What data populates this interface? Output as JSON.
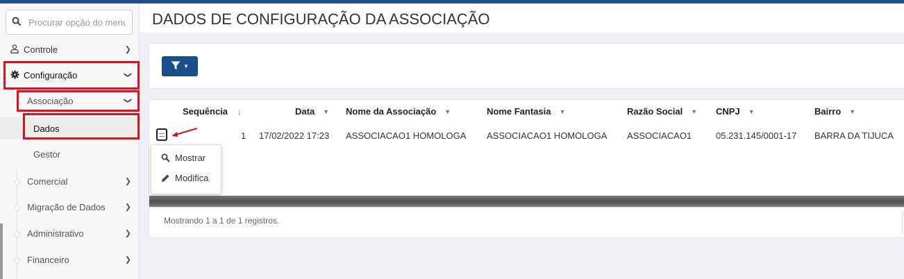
{
  "sidebar": {
    "search_placeholder": "Procurar opção do menu",
    "items": [
      {
        "label": "Controle"
      },
      {
        "label": "Configuração"
      },
      {
        "label": "Associação"
      },
      {
        "label": "Dados"
      },
      {
        "label": "Gestor"
      },
      {
        "label": "Comercial"
      },
      {
        "label": "Migração de Dados"
      },
      {
        "label": "Administrativo"
      },
      {
        "label": "Financeiro"
      }
    ]
  },
  "page": {
    "title": "DADOS DE CONFIGURAÇÃO DA ASSOCIAÇÃO"
  },
  "table": {
    "columns": [
      "Sequência",
      "Data",
      "Nome da Associação",
      "Nome Fantasia",
      "Razão Social",
      "CNPJ",
      "Bairro"
    ],
    "rows": [
      [
        "1",
        "17/02/2022 17:23",
        "ASSOCIACAO1 HOMOLOGA",
        "ASSOCIACAO1 HOMOLOGA",
        "ASSOCIACAO1",
        "05.231.145/0001-17",
        "BARRA DA TIJUCA"
      ]
    ],
    "row_menu": {
      "show": "Mostrar",
      "edit": "Modifica"
    },
    "footer": "Mostrando 1 a 1 de 1 registros."
  },
  "colors": {
    "accent": "#1a4d8c",
    "highlight": "#e0101c"
  }
}
